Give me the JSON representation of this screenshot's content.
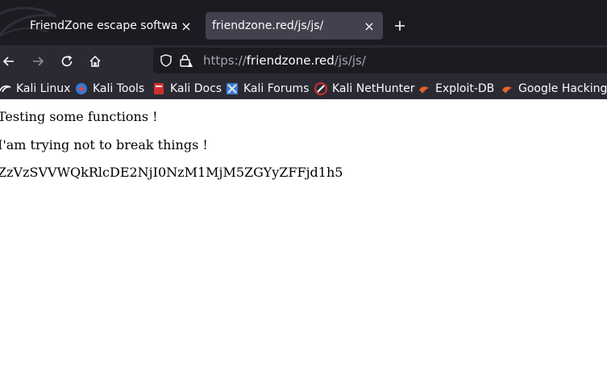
{
  "tabs": [
    {
      "title": "FriendZone escape software",
      "close": "×",
      "active": false
    },
    {
      "title": "friendzone.red/js/js/",
      "close": "×",
      "active": true
    }
  ],
  "new_tab_icon": "plus-icon",
  "nav": {
    "back_icon": "arrow-left-icon",
    "forward_icon": "arrow-right-icon",
    "reload_icon": "reload-icon",
    "home_icon": "home-icon"
  },
  "urlbar": {
    "scheme": "https://",
    "host": "friendzone.red",
    "path": "/js/js/"
  },
  "bookmarks": [
    {
      "label": "Kali Linux",
      "icon": "kali-dragon-icon"
    },
    {
      "label": "Kali Tools",
      "icon": "kali-tools-icon"
    },
    {
      "label": "Kali Docs",
      "icon": "kali-docs-icon"
    },
    {
      "label": "Kali Forums",
      "icon": "kali-forums-icon"
    },
    {
      "label": "Kali NetHunter",
      "icon": "nethunter-icon"
    },
    {
      "label": "Exploit-DB",
      "icon": "exploit-db-icon"
    },
    {
      "label": "Google Hacking DB",
      "icon": "ghdb-icon"
    }
  ],
  "content": {
    "line1": "Testing some functions !",
    "line2": "I'am trying not to break things !",
    "line3": "ZzVzSVVWQkRlcDE2NjI0NzM1MjM5ZGYyZFFjd1h5"
  },
  "colors": {
    "tabstrip_bg": "#1c1b22",
    "toolbar_bg": "#2b2a33",
    "active_tab_bg": "#42414d",
    "text_light": "#fbfbfe"
  }
}
